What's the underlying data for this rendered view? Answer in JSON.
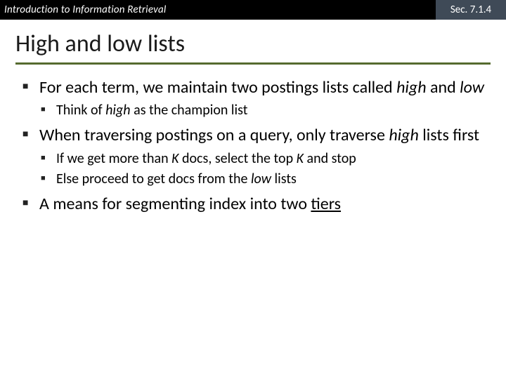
{
  "header": {
    "course": "Introduction to Information Retrieval",
    "section": "Sec. 7.1.4"
  },
  "title": "High and low lists",
  "bullets": {
    "b1_pre": "For each term, we maintain two postings lists called ",
    "b1_hi": "high",
    "b1_mid": " and ",
    "b1_lo": "low",
    "b1a_pre": "Think of ",
    "b1a_hi": "high",
    "b1a_post": " as the champion list",
    "b2_pre": "When traversing postings on a query, only traverse ",
    "b2_hi": "high",
    "b2_post": " lists first",
    "b2a_pre": "If we get more than ",
    "b2a_k1": "K",
    "b2a_mid": " docs, select the top ",
    "b2a_k2": "K",
    "b2a_post": " and stop",
    "b2b_pre": "Else proceed to get docs from the ",
    "b2b_lo": "low",
    "b2b_post": " lists",
    "b3_pre": "A means for segmenting index into two ",
    "b3_tiers": "tiers"
  }
}
